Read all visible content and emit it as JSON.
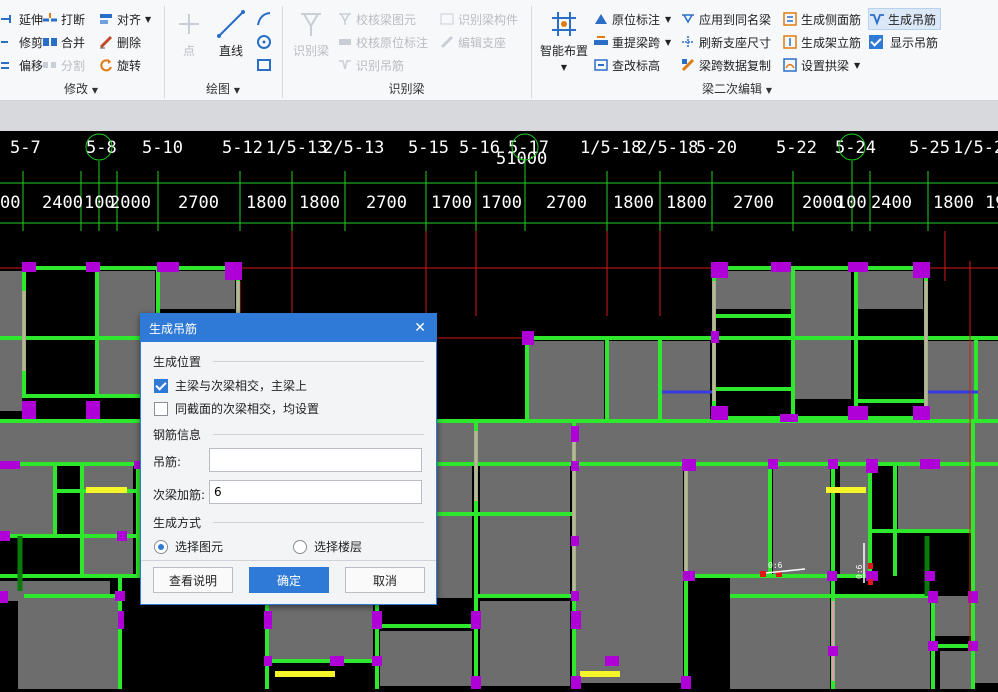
{
  "ribbon": {
    "modify": {
      "caption": "修改",
      "items": [
        "延伸",
        "打断",
        "对齐",
        "修剪",
        "合并",
        "删除",
        "偏移",
        "分割",
        "旋转"
      ]
    },
    "draw": {
      "caption": "绘图",
      "point": "点",
      "line": "直线"
    },
    "identify_beam": {
      "caption": "识别梁",
      "identify": "识别梁",
      "check_beam_diagram": "校核梁图元",
      "identify_beam_member": "识别梁构件",
      "check_original_annotation": "校核原位标注",
      "edit_support": "编辑支座",
      "identify_hanger": "识别吊筋"
    },
    "beam_secondary_edit": {
      "caption": "梁二次编辑",
      "smart_layout": "智能布置",
      "original_annotation": "原位标注",
      "relift_span": "重提梁跨",
      "query_elevation": "查改标高",
      "apply_same_name": "应用到同名梁",
      "refresh_support_size": "刷新支座尺寸",
      "span_data_copy": "梁跨数据复制",
      "gen_side_bar": "生成侧面筋",
      "gen_erection_bar": "生成架立筋",
      "set_camber": "设置拱梁",
      "gen_hanger": "生成吊筋",
      "show_hanger": "显示吊筋"
    }
  },
  "canvas": {
    "axis_labels": [
      "5-7",
      "5-8",
      "5-10",
      "5-12",
      "1/5-13",
      "2/5-13",
      "5-15",
      "5-16",
      "5-17",
      "1/5-18",
      "2/5-18",
      "5-20",
      "5-22",
      "5-24",
      "5-25",
      "1/5-2"
    ],
    "total_dimension": "51000",
    "dimensions": [
      "00",
      "2400",
      "100",
      "2000",
      "2700",
      "1800",
      "1800",
      "2700",
      "1700",
      "1700",
      "2700",
      "1800",
      "1800",
      "2700",
      "2000",
      "100",
      "2400",
      "1800",
      "19"
    ],
    "rebar_marks": [
      "0:6",
      "0:6"
    ],
    "colors": {
      "beam_green": "#2ee82e",
      "column_magenta": "#b000d8",
      "slab_gray": "#6d6d6d",
      "axis_red": "#d01818",
      "yellow": "#f5f52a"
    }
  },
  "dialog": {
    "title": "生成吊筋",
    "section_position": "生成位置",
    "opt_main_secondary": "主梁与次梁相交，主梁上",
    "opt_main_secondary_checked": true,
    "opt_same_section": "同截面的次梁相交，均设置",
    "opt_same_section_checked": false,
    "section_rebar": "钢筋信息",
    "label_hanger": "吊筋:",
    "value_hanger": "",
    "label_additional": "次梁加筋:",
    "value_additional": "6",
    "section_method": "生成方式",
    "radio_select_element": "选择图元",
    "radio_select_floor": "选择楼层",
    "selected_method": "选择图元",
    "btn_help": "查看说明",
    "btn_ok": "确定",
    "btn_cancel": "取消"
  }
}
